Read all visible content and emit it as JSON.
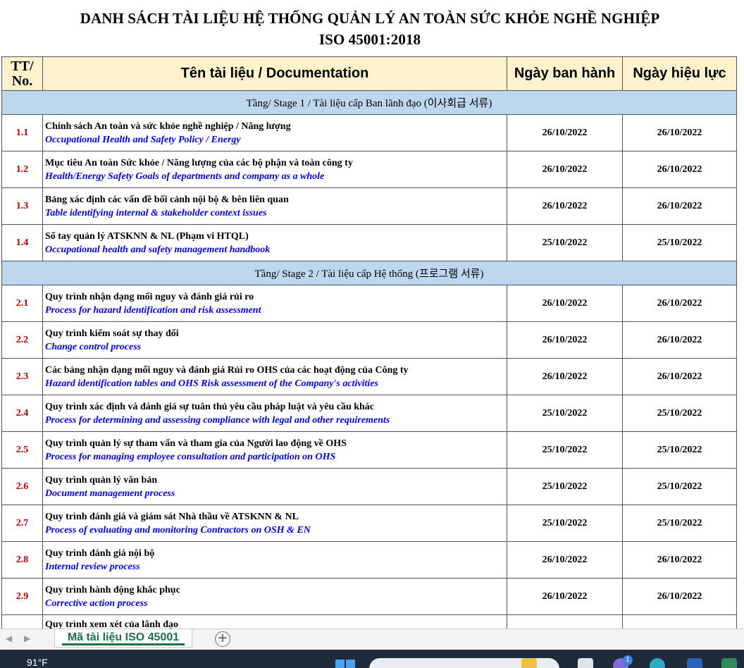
{
  "title_line1": "DANH SÁCH TÀI LIỆU HỆ THỐNG QUẢN LÝ AN TOÀN SỨC KHỎE NGHỀ NGHIỆP",
  "title_line2": "ISO 45001:2018",
  "columns": {
    "no": "TT/\nNo.",
    "name": "Tên tài liệu / Documentation",
    "issue_date": "Ngày ban hành",
    "effective_date": "Ngày hiệu lực"
  },
  "stages": [
    {
      "label": "Tầng/ Stage 1 / Tài liệu cấp Ban lãnh đạo (이사회급 서류)",
      "rows": [
        {
          "no": "1.1",
          "vn": "Chính sách An toàn và sức khỏe nghề nghiệp / Năng lượng",
          "en": "Occupational Health and Safety Policy / Energy",
          "issue": "26/10/2022",
          "effective": "26/10/2022"
        },
        {
          "no": "1.2",
          "vn": "Mục tiêu An toàn Sức khỏe / Năng lượng của các bộ phận và toàn công ty",
          "en": "Health/Energy Safety Goals of departments and company as a whole",
          "issue": "26/10/2022",
          "effective": "26/10/2022"
        },
        {
          "no": "1.3",
          "vn": "Bảng xác định các vấn đề bối cảnh nội bộ & bên liên quan",
          "en": "Table identifying internal & stakeholder context issues",
          "issue": "26/10/2022",
          "effective": "26/10/2022"
        },
        {
          "no": "1.4",
          "vn": "Sổ tay quản lý ATSKNN & NL (Phạm vi HTQL)",
          "en": "Occupational health and safety management handbook",
          "issue": "25/10/2022",
          "effective": "25/10/2022"
        }
      ]
    },
    {
      "label": "Tầng/ Stage 2 / Tài liệu cấp Hệ thống (프로그램 서류)",
      "rows": [
        {
          "no": "2.1",
          "vn": "Quy trình nhận dạng mối nguy và đánh giá rủi ro",
          "en": "Process for hazard identification and risk assessment",
          "issue": "26/10/2022",
          "effective": "26/10/2022"
        },
        {
          "no": "2.2",
          "vn": "Quy trình kiểm soát sự thay đổi",
          "en": "Change control process",
          "issue": "26/10/2022",
          "effective": "26/10/2022"
        },
        {
          "no": "2.3",
          "vn": "Các bảng nhận dạng mối nguy và đánh giá Rủi ro OHS của các hoạt động của Công ty",
          "en": "Hazard identification tables and OHS Risk assessment of the Company's activities",
          "issue": "26/10/2022",
          "effective": "26/10/2022"
        },
        {
          "no": "2.4",
          "vn": "Quy trình xác định và đánh giá sự tuân thủ yêu cầu pháp luật và yêu cầu khác",
          "en": "Process for determining and assessing compliance with legal and other requirements",
          "issue": "25/10/2022",
          "effective": "25/10/2022"
        },
        {
          "no": "2.5",
          "vn": "Quy trình quản lý sự tham vấn và tham gia của Người lao động về OHS",
          "en": "Process for managing employee consultation and participation on OHS",
          "issue": "25/10/2022",
          "effective": "25/10/2022"
        },
        {
          "no": "2.6",
          "vn": "Quy trình quản lý văn bản",
          "en": "Document management process",
          "issue": "25/10/2022",
          "effective": "25/10/2022"
        },
        {
          "no": "2.7",
          "vn": "Quy trình đánh giá và giám sát Nhà thầu về ATSKNN & NL",
          "en": "Process of evaluating and monitoring Contractors on OSH & EN",
          "issue": "25/10/2022",
          "effective": "25/10/2022"
        },
        {
          "no": "2.8",
          "vn": "Quy trình đánh giá nội bộ",
          "en": "Internal review process",
          "issue": "26/10/2022",
          "effective": "26/10/2022"
        },
        {
          "no": "2.9",
          "vn": "Quy trình hành động khắc phục",
          "en": "Corrective action process",
          "issue": "26/10/2022",
          "effective": "26/10/2022"
        }
      ]
    }
  ],
  "partial_row_text": "Quy trình xem xét của lãnh đạo",
  "sheet_tab": "Mã tài liệu ISO 45001",
  "taskbar": {
    "weather": "91°F",
    "notification_count": "1"
  },
  "colors": {
    "header_bg": "#fff2cc",
    "stage_bg": "#bdd7ee",
    "number_red": "#c00000",
    "english_blue": "#0000ff",
    "tab_green": "#1e7145"
  }
}
